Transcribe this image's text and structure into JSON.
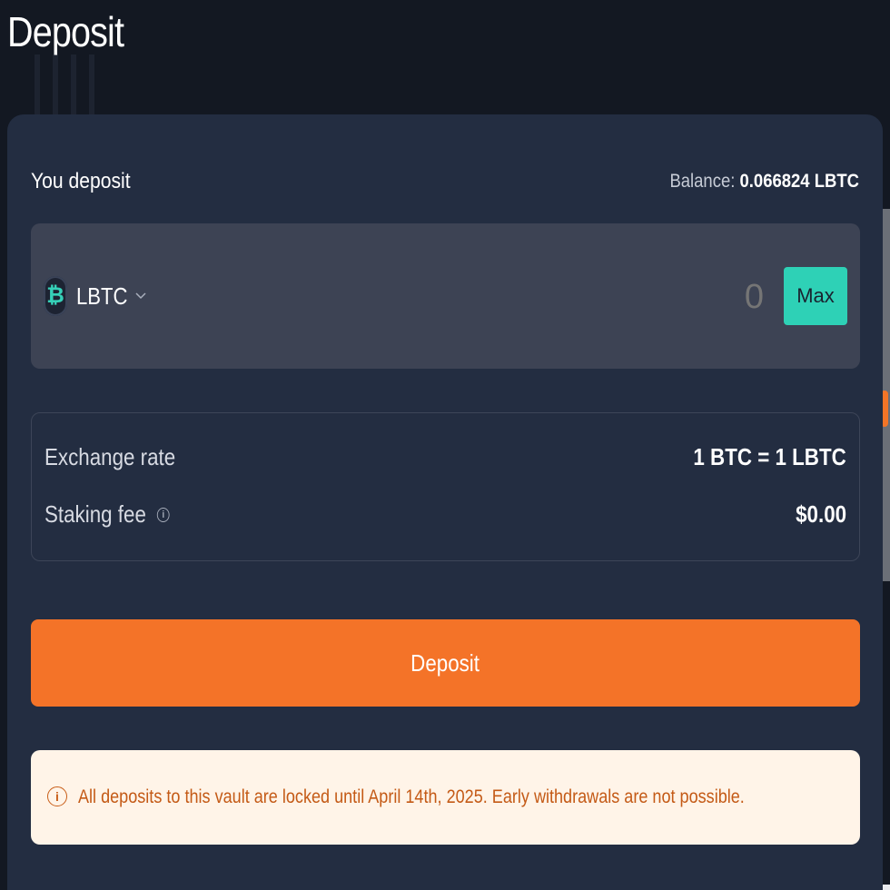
{
  "page": {
    "title": "Deposit"
  },
  "deposit": {
    "label": "You deposit",
    "balance_label": "Balance:",
    "balance_value": "0.066824 LBTC"
  },
  "token": {
    "symbol": "LBTC",
    "icon": "bitcoin-icon",
    "icon_glyph": "₿"
  },
  "amount": {
    "value": "",
    "placeholder": "0"
  },
  "max_label": "Max",
  "info": {
    "exchange_rate_label": "Exchange rate",
    "exchange_rate_value": "1 BTC = 1 LBTC",
    "staking_fee_label": "Staking fee",
    "staking_fee_value": "$0.00",
    "info_glyph": "i"
  },
  "deposit_button_label": "Deposit",
  "notice": {
    "icon_glyph": "i",
    "text": "All deposits to this vault are locked until April 14th, 2025. Early withdrawals are not possible."
  },
  "colors": {
    "background": "#131822",
    "card": "#232d41",
    "accent_orange": "#f47328",
    "accent_teal": "#2ed1b6",
    "notice_bg": "#fff4e8",
    "notice_text": "#c45a16"
  }
}
